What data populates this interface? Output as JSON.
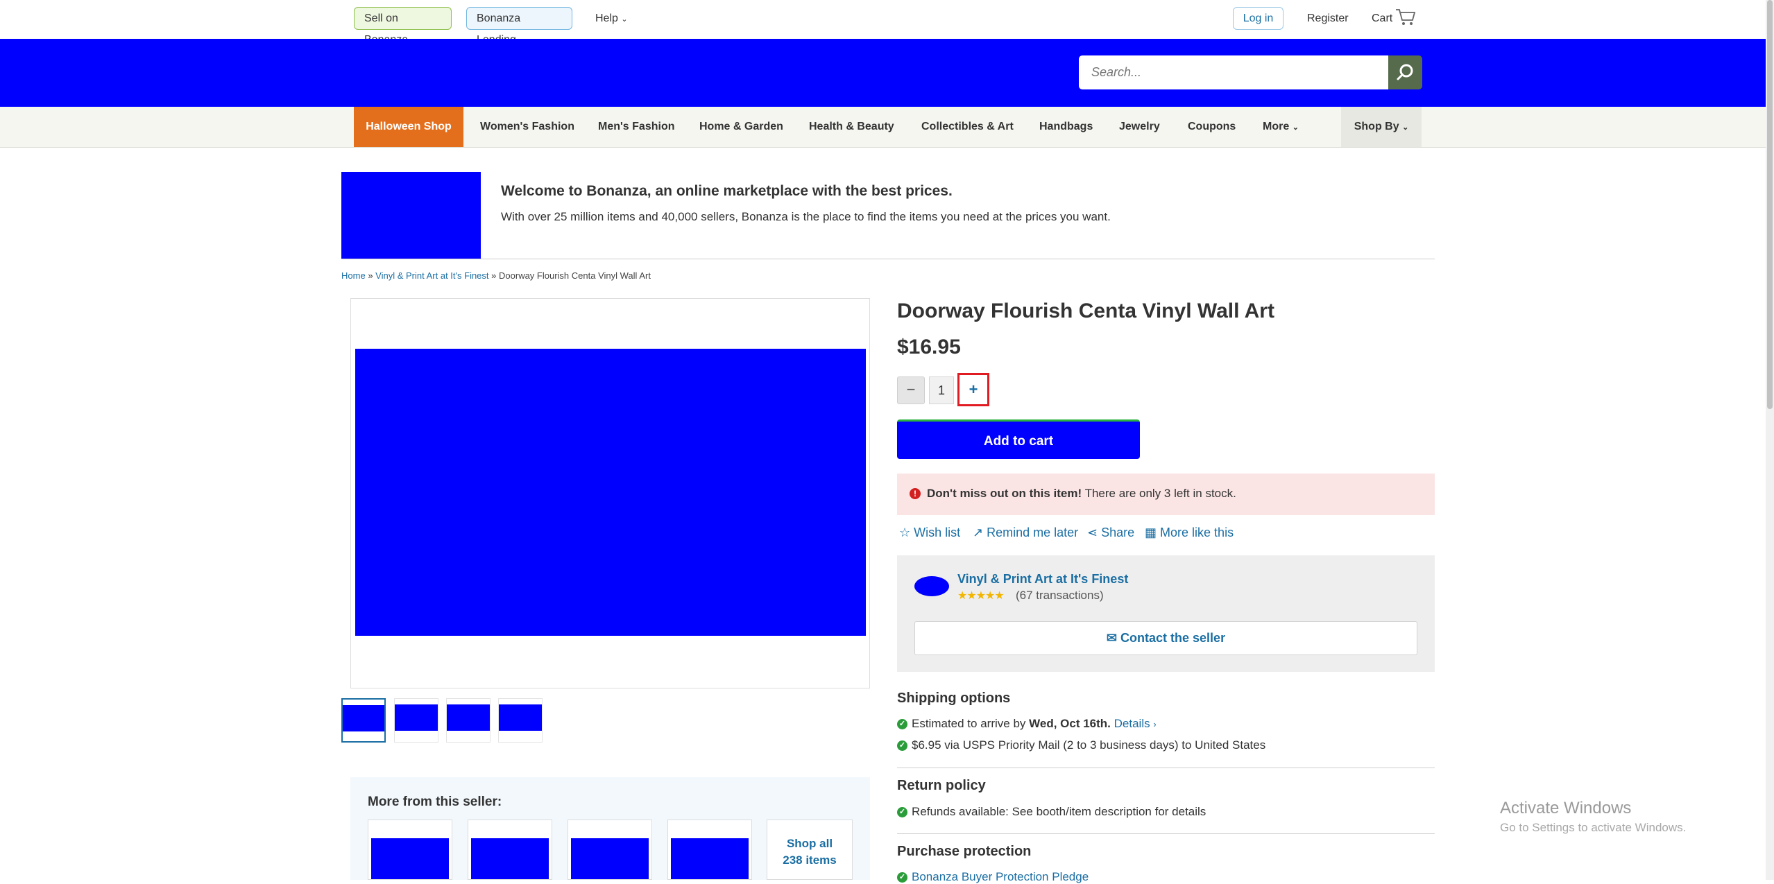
{
  "topbar": {
    "sell": "Sell on Bonanza",
    "lending": "Bonanza Lending",
    "help": "Help",
    "login": "Log in",
    "register": "Register",
    "cart": "Cart",
    "cart_icon": "cart-icon"
  },
  "search": {
    "placeholder": "Search...",
    "icon": "search-icon"
  },
  "nav": {
    "items": [
      "Halloween Shop",
      "Women's Fashion",
      "Men's Fashion",
      "Home & Garden",
      "Health & Beauty",
      "Collectibles & Art",
      "Handbags",
      "Jewelry",
      "Coupons",
      "More",
      "Shop By"
    ]
  },
  "welcome": {
    "title": "Welcome to Bonanza, an online marketplace with the best prices.",
    "text": "With over 25 million items and 40,000 sellers, Bonanza is the place to find the items you need at the prices you want."
  },
  "breadcrumb": {
    "home": "Home",
    "sep": "»",
    "store": "Vinyl & Print Art at It's Finest",
    "current": "Doorway Flourish Centa Vinyl Wall Art"
  },
  "product": {
    "title": "Doorway Flourish Centa Vinyl Wall Art",
    "price": "$16.95",
    "qty": "1",
    "minus": "−",
    "plus": "+",
    "add_to_cart": "Add to cart"
  },
  "alert": {
    "strong": "Don't miss out on this item!",
    "text": "There are only 3 left in stock.",
    "icon": "!"
  },
  "actions": {
    "wishlist": "Wish list",
    "remind": "Remind me later",
    "share": "Share",
    "more_like": "More like this"
  },
  "seller": {
    "name": "Vinyl & Print Art at It's Finest",
    "stars": "★★★★★",
    "rating": 5,
    "transactions": "(67 transactions)",
    "contact": "Contact the seller"
  },
  "shipping": {
    "heading": "Shipping options",
    "arrive_prefix": "Estimated to arrive by",
    "arrive_date": "Wed, Oct 16th.",
    "details": "Details",
    "method": "$6.95 via USPS Priority Mail (2 to 3 business days) to United States"
  },
  "returns": {
    "heading": "Return policy",
    "text": "Refunds available: See booth/item description for details"
  },
  "protection": {
    "heading": "Purchase protection",
    "link": "Bonanza Buyer Protection Pledge"
  },
  "more_seller": {
    "title": "More from this seller:",
    "shop_all": "Shop all 238 items"
  },
  "watermark": {
    "title": "Activate Windows",
    "sub": "Go to Settings to activate Windows."
  },
  "colors": {
    "header_blue": "#0000ff",
    "halloween": "#e36f1c",
    "link": "#1a6ea3",
    "highlight": "#e11b22"
  }
}
